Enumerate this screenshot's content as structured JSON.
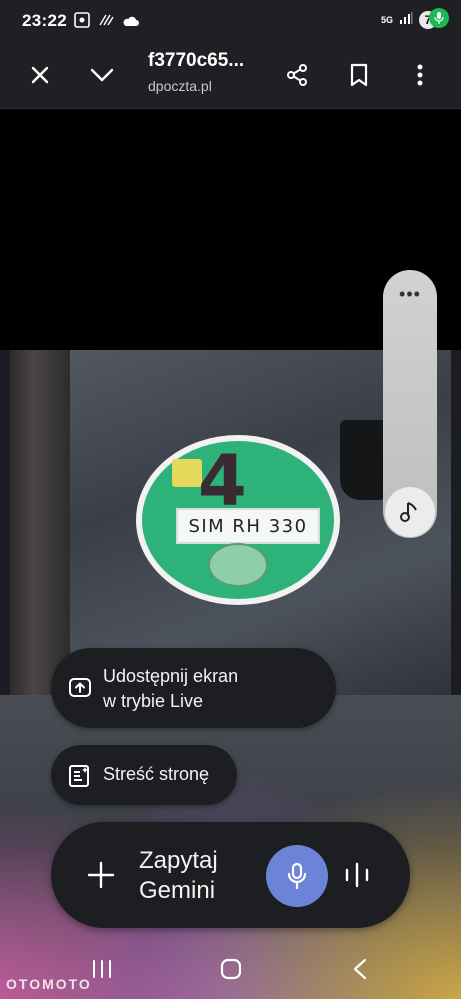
{
  "status_bar": {
    "time": "23:22",
    "network": "5G",
    "notification_count": "7"
  },
  "toolbar": {
    "title": "f3770c65...",
    "domain": "dpoczta.pl"
  },
  "photo": {
    "sticker_number": "4",
    "plate_text": "SIM RH 330"
  },
  "actions": {
    "share_screen_line1": "Udostępnij ekran",
    "share_screen_line2": "w trybie Live",
    "summarize": "Streść stronę"
  },
  "gemini": {
    "ask_line1": "Zapytaj",
    "ask_line2": "Gemini"
  },
  "watermark": "OTOMOTO",
  "colors": {
    "accent_mic": "#6b84d8",
    "badge_mic": "#1db954",
    "sticker_green": "#2db37a"
  }
}
